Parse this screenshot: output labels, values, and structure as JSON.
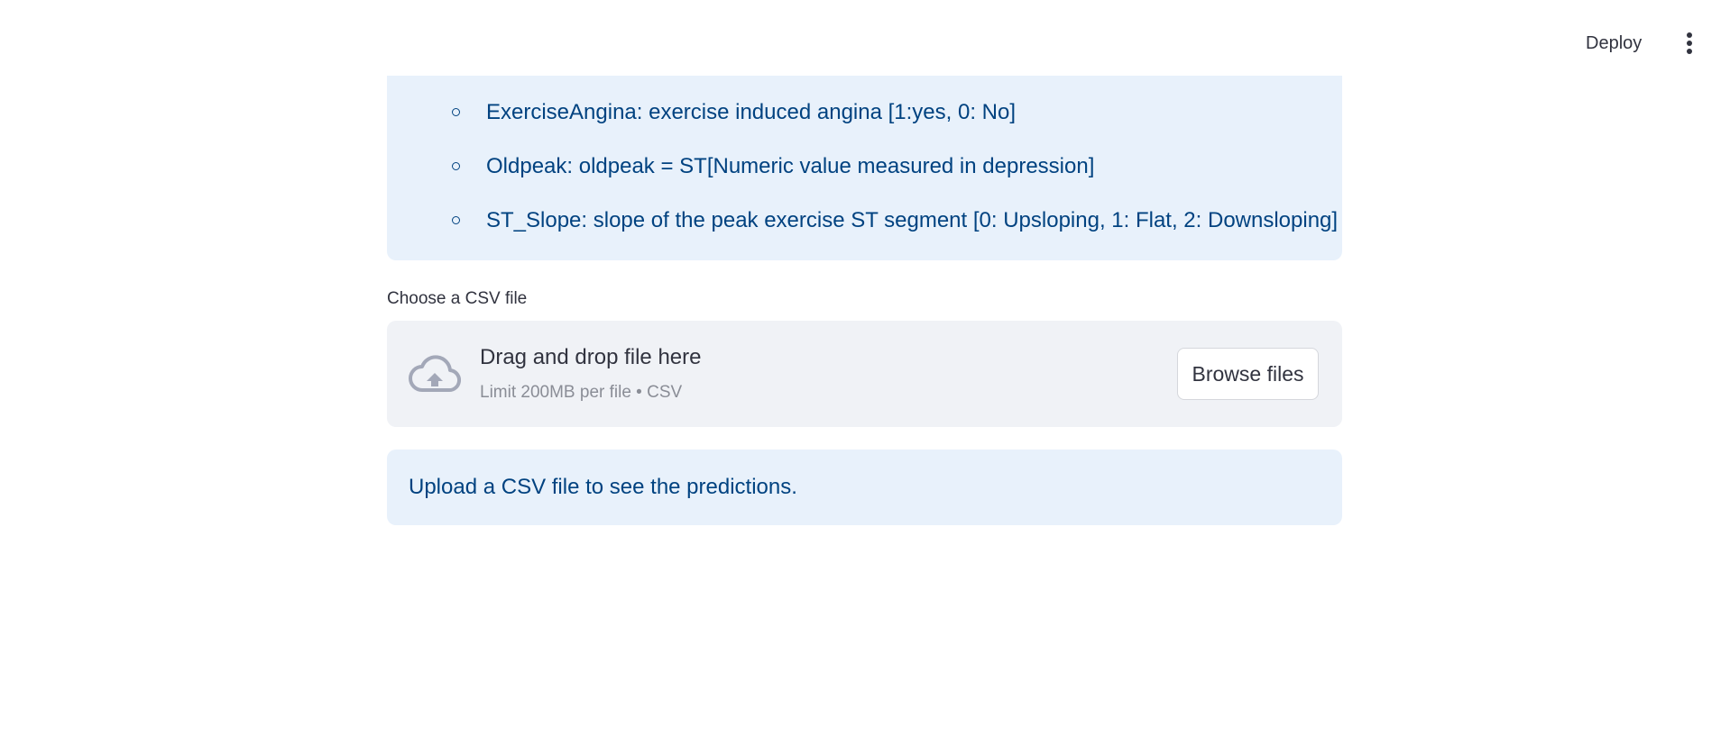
{
  "header": {
    "deploy_label": "Deploy",
    "menu_icon": "vertical-ellipsis-icon"
  },
  "info": {
    "items": [
      {
        "label": "ExerciseAngina: exercise induced angina [1:yes, 0: No]"
      },
      {
        "label": "Oldpeak: oldpeak = ST[Numeric value measured in depression]"
      },
      {
        "label": "ST_Slope: slope of the peak exercise ST segment [0: Upsloping, 1: Flat, 2: Downsloping]"
      }
    ]
  },
  "uploader": {
    "label": "Choose a CSV file",
    "title": "Drag and drop file here",
    "limit": "Limit 200MB per file • CSV",
    "browse_label": "Browse files",
    "icon": "cloud-upload-icon"
  },
  "alert": {
    "text": "Upload a CSV file to see the predictions."
  },
  "colors": {
    "info_bg": "#e8f1fb",
    "info_text": "#004280",
    "dropzone_bg": "#f0f2f6",
    "text": "#31333f"
  }
}
